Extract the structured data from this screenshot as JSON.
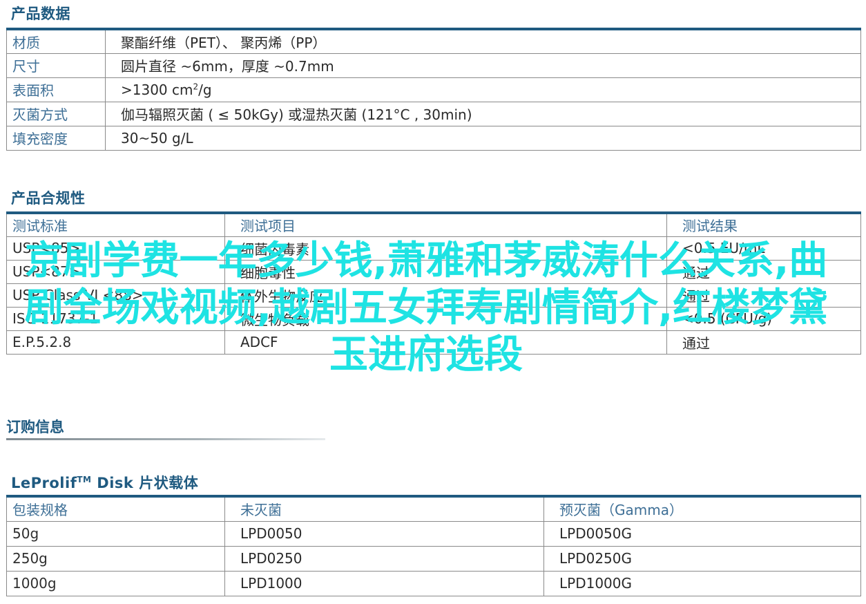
{
  "sections": {
    "specs_title": "产品数据",
    "compliance_title": "产品合规性",
    "order_title": "订购信息",
    "disk_title_prefix": "LeProlif",
    "disk_title_tm": "TM",
    "disk_title_suffix": " Disk 片状载体"
  },
  "specs": [
    {
      "key": "材质",
      "value": "聚酯纤维（PET）、 聚丙烯（PP）"
    },
    {
      "key": "尺寸",
      "value": "圆片直径 ~6mm，厚度 ~0.7mm"
    },
    {
      "key": "表面积",
      "value_prefix": ">1300 cm",
      "value_sup": "2",
      "value_suffix": "/g"
    },
    {
      "key": "灭菌方式",
      "value": "伽马辐照灭菌 ( ≤ 50kGy) 或湿热灭菌 (121°C , 30min)"
    },
    {
      "key": "填充密度",
      "value": "30~50 g/L"
    }
  ],
  "compliance": {
    "headers": [
      "测试标准",
      "测试项目",
      "测试结果"
    ],
    "rows": [
      [
        "USP<85>",
        "细菌内毒素",
        "<0.5 EU/mL"
      ],
      [
        "USP<87>",
        "细胞毒性",
        "通过"
      ],
      [
        "USP Class VI <88>",
        "体外生物反应",
        "通过"
      ],
      [
        "ISO 11737-1",
        "微生物负载",
        "<0.5 (CFU/g)"
      ],
      [
        "E.P.5.2.8",
        "ADCF",
        "通过"
      ]
    ]
  },
  "disk": {
    "headers": [
      "包装规格",
      "未灭菌",
      "预灭菌（Gamma）"
    ],
    "rows": [
      [
        "50g",
        "LPD0050",
        "LPD0050G"
      ],
      [
        "250g",
        "LPD0250",
        "LPD0250G"
      ],
      [
        "1000g",
        "LPD1000",
        "LPD1000G"
      ]
    ]
  },
  "overlay_text": "京剧学费一年多少钱,萧雅和茅威涛什么关系,曲剧全场戏视频,越剧五女拜寿剧情简介,红楼梦黛玉进府选段",
  "colors": {
    "accent": "#1f5a80",
    "key_text": "#3e6f96",
    "overlay": "#1ee3e3"
  }
}
